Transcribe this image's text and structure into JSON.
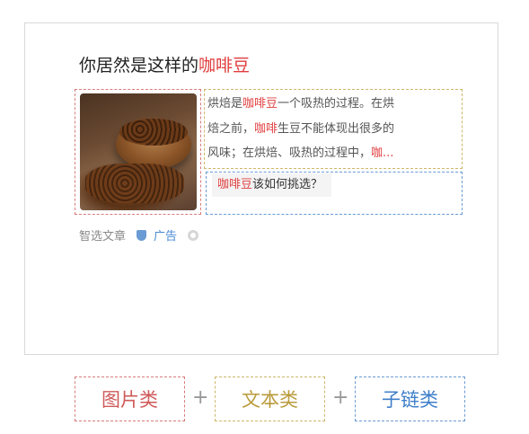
{
  "card": {
    "title_prefix": "你居然是这样的",
    "title_highlight": "咖啡豆",
    "description": {
      "line1_a": "烘焙是",
      "line1_hl": "咖啡豆",
      "line1_b": "一个吸热的过程。在烘",
      "line2_a": "焙之前，",
      "line2_hl": "咖啡",
      "line2_b": "生豆不能体现出很多的",
      "line3_a": "风味；在烘焙、吸热的过程中，",
      "line3_hl": "咖..."
    },
    "sublink": {
      "highlight": "咖啡豆",
      "text": "该如何挑选？"
    },
    "meta": {
      "source": "智选文章",
      "ad_label": "广告"
    }
  },
  "legend": {
    "image_label": "图片类",
    "text_label": "文本类",
    "link_label": "子链类",
    "plus": "+"
  },
  "colors": {
    "highlight": "#e03c3c",
    "image_box": "#d97b7b",
    "text_box": "#cdb76a",
    "link_box": "#6a9bd4"
  }
}
